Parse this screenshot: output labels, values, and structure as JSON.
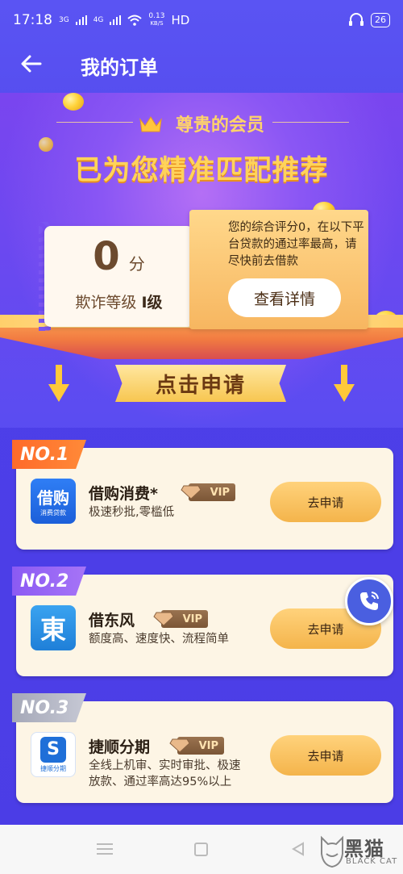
{
  "status_bar": {
    "time": "17:18",
    "signal_1": "3G",
    "signal_2": "4G",
    "speed_value": "0.13",
    "speed_unit": "KB/S",
    "hd": "HD",
    "battery": "26"
  },
  "nav": {
    "title": "我的订单"
  },
  "hero": {
    "member_label": "尊贵的会员",
    "headline": "已为您精准匹配推荐",
    "score": "0",
    "score_unit": "分",
    "fraud_label": "欺诈等级",
    "fraud_level": "I级",
    "info_text": "您的综合评分0，在以下平台贷款的通过率最高，请尽快前去借款",
    "detail_button": "查看详情",
    "apply_banner": "点击申请"
  },
  "products": [
    {
      "rank": "NO.1",
      "name": "借购消费*",
      "vip": "VIP",
      "desc_line1": "极速秒批,零槛低",
      "desc_line2": "",
      "logo_text": "借购",
      "logo_sub": "消费贷款",
      "apply": "去申请"
    },
    {
      "rank": "NO.2",
      "name": "借东风",
      "vip": "VIP",
      "desc_line1": "额度高、速度快、流程简单",
      "desc_line2": "",
      "logo_text": "東",
      "logo_sub": "",
      "apply": "去申请"
    },
    {
      "rank": "NO.3",
      "name": "捷顺分期",
      "vip": "VIP",
      "desc_line1": "全线上机审、实时审批、极速",
      "desc_line2": "放款、通过率高达95%以上",
      "logo_text": "S",
      "logo_sub": "捷顺分期",
      "apply": "去申请"
    }
  ],
  "watermark": {
    "cn": "黑猫",
    "en": "BLACK CAT"
  },
  "colors": {
    "primary": "#4d3fe8",
    "gold": "#ffd35a",
    "card_bg": "#fdf5e5",
    "button": "#f4b44b"
  }
}
